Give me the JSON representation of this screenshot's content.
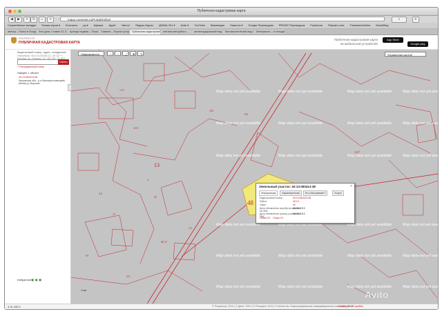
{
  "browser": {
    "window_title": "Публичная кадастровая карта",
    "url": "maps.rosreestr.ru/PortalOnline/",
    "bookmarks": [
      "Сохранённые вкладки",
      "Новая серия ▾",
      "Контакты",
      "ру ▾",
      "Афиша",
      "Apple",
      "Yahoo!",
      "Яндекс.Карты",
      "@MAIL.RU ▾",
      "Avito ▾",
      "YouTube",
      "Википедия",
      "Новости ▾",
      "Google Переводчик",
      "PROMT Переводчик",
      "Facebook",
      "Shazam.com",
      "TranslatesOnline",
      "NewsBlog"
    ],
    "tabs": [
      "аватар – Поиск в Google",
      "Фон дата, Ставки 13, 5…",
      "Аренда недвиж – Поиск в Google",
      "Главная – Портал услуг",
      "Публичная кадастровая карта",
      "пензенский рубли к…",
      "железнодорожный вид 236…",
      "Вспомогательный вид 330 r…",
      "Материалы – от внедрен…"
    ]
  },
  "header": {
    "org": "РОСРЕЕСТР",
    "brand": "ПУБЛИЧНАЯ КАДАСТРОВАЯ КАРТА",
    "mobile_text_1": "Публичная кадастровая карта",
    "mobile_text_2": "на мобильном устройстве",
    "appstore": "App Store",
    "googleplay": "Google play"
  },
  "sidebar": {
    "search_hint": "Кадастровый номер, адрес, координаты",
    "search_example": "Например: 40:13:100208:12, 40:13:*:*, Москва, ул. Ленина, 12 / 55.754, 37.621",
    "search_button": "Найти",
    "extended_search": "+ Расширенный поиск",
    "found_label": "Найден 1 объект",
    "result_number": "40:13:060413:38",
    "result_address": "Калужская обл., р-н Малоярославецкий, вблизи д. Воронки",
    "favorites_label": "Избранное",
    "favorites_icons": "▣ ▣ ▣"
  },
  "map": {
    "toolbar_selector": "Недвижимость",
    "layers_selector": "Управление картой",
    "placeholder_text": "Map data not yet available",
    "parcel_labels": [
      "1:21",
      "41:8",
      "103",
      "154",
      "13",
      "4",
      "48",
      "55",
      "1027",
      "13",
      "60:11",
      "2:3",
      "2:6",
      "7:8",
      "3:9"
    ],
    "scale_label": "1 км",
    "popup": {
      "title": "Земельный участок: 40:13:060413:38",
      "tabs": [
        "Информация",
        "Характеристики",
        "Кто обслуживает?",
        "Услуги"
      ],
      "rows": [
        {
          "label": "Кадастровый номер:",
          "value": "40:13:060413:38",
          "red": true
        },
        {
          "label": "Район:",
          "value": "40:13",
          "red": true
        },
        {
          "label": "Округ:",
          "value": "40",
          "red": true
        },
        {
          "label": "Дата обновления атрибутов участка на ПКК:",
          "value": "08.05.2013",
          "red": false
        },
        {
          "label": "Дата обновления границ участка на ПКК:",
          "value": "08.05.2013",
          "red": false
        }
      ],
      "link_show": "Показ ОУ",
      "link_show2": "Показ ЗУ"
    }
  },
  "status": {
    "coords": "4.01.445.2",
    "copyright": "© Росреестр, 2013 | © Дата+ 2013 | © Роскарта, 2013 | © Агентство «Картографические информационные системы», 2013",
    "report": "Сообщить об ошибке"
  },
  "watermark": "Avito"
}
